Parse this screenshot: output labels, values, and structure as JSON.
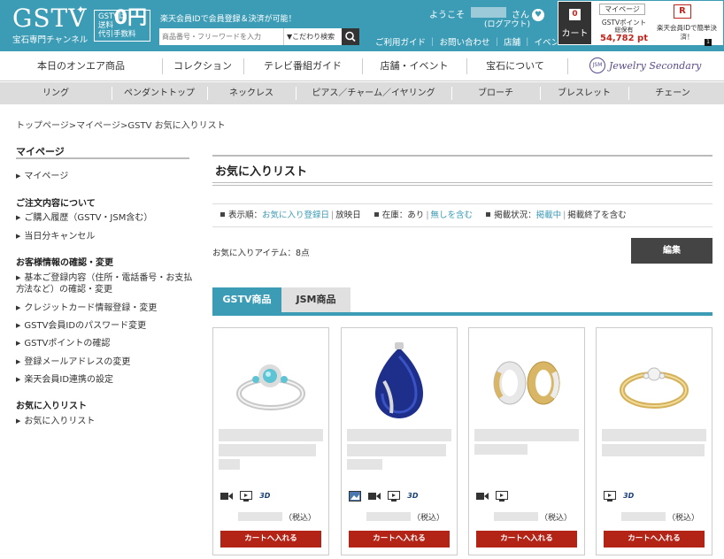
{
  "header": {
    "logo_text": "GSTV",
    "logo_sub": "宝石専門チャンネル",
    "free_line1": "GSTVは",
    "free_line2": "送料",
    "free_line3": "代引手数料",
    "free_zero": "0円",
    "promo": "楽天会員IDで会員登録＆決済が可能！",
    "search_placeholder": "商品番号・フリーワードを入力",
    "kodawari": "▼こだわり検索",
    "welcome": "ようこそ",
    "san": "さん",
    "logout": "(ログアウト)",
    "links": "ご利用ガイド ｜ お問い合わせ ｜ 店舗 ｜ イベント",
    "cart_count": "0",
    "cart_label": "カート",
    "mypage": "マイページ",
    "points_label": "GSTVポイント",
    "points_sub": "総保有",
    "points_value": "54,782 pt",
    "rakuten_mark": "R",
    "rakuten_text": "楽天会員IDで簡単決済！",
    "corner_badge": "1"
  },
  "main_nav": [
    "本日のオンエア商品",
    "コレクション",
    "テレビ番組ガイド",
    "店舗・イベント",
    "宝石について"
  ],
  "jsm_logo": "JSM",
  "jsm_text": "Jewelry Secondary Market",
  "category_nav": [
    "リング",
    "ペンダントトップ",
    "ネックレス",
    "ピアス／チャーム／イヤリング",
    "ブローチ",
    "ブレスレット",
    "チェーン"
  ],
  "breadcrumb": "トップページ>マイページ>GSTV お気に入りリスト",
  "sidebar": {
    "title": "マイページ",
    "mypage_link": "マイページ",
    "order_heading": "ご注文内容について",
    "order_items": [
      "ご購入履歴（GSTV・JSM含む）",
      "当日分キャンセル"
    ],
    "info_heading": "お客様情報の確認・変更",
    "info_item_1a": "基本ご登録内容（住所・電話番号・お支払方",
    "info_item_1b": "法など）の確認・変更",
    "info_items": [
      "クレジットカード情報登録・変更",
      "GSTV会員IDのパスワード変更",
      "GSTVポイントの確認",
      "登録メールアドレスの変更",
      "楽天会員ID連携の設定"
    ],
    "fav_heading": "お気に入りリスト",
    "fav_item": "お気に入りリスト"
  },
  "content": {
    "title": "お気に入りリスト",
    "filter_order_label": "表示順：",
    "filter_order_active": "お気に入り登録日",
    "filter_order_other": "放映日",
    "filter_stock_label": "在庫：",
    "filter_stock_active": "あり",
    "filter_stock_other": "無しを含む",
    "filter_status_label": "掲載状況：",
    "filter_status_active": "掲載中",
    "filter_status_other": "掲載終了を含む",
    "count_text": "お気に入りアイテム：8点",
    "edit_button": "編集",
    "tab_gstv": "GSTV商品",
    "tab_jsm": "JSM商品"
  },
  "products": [
    {
      "image": "aquamarine-diamond-ring",
      "icons": [
        "video-icon",
        "tv-icon",
        "3d-icon"
      ],
      "tax": "（税込）",
      "cart": "カートへ入れる"
    },
    {
      "image": "sapphire-pendant",
      "icons": [
        "photo-icon",
        "video-icon",
        "tv-icon",
        "3d-icon"
      ],
      "tax": "（税込）",
      "cart": "カートへ入れる"
    },
    {
      "image": "gold-hoop-earrings",
      "icons": [
        "video-icon",
        "tv-icon"
      ],
      "tax": "（税込）",
      "cart": "カートへ入れる"
    },
    {
      "image": "gold-diamond-ring",
      "icons": [
        "tv-icon",
        "3d-icon"
      ],
      "tax": "（税込）",
      "cart": "カートへ入れる"
    }
  ],
  "icon_3d": "3D",
  "colors": {
    "brand": "#3c9cb6",
    "cart_red": "#b32417",
    "points_red": "#c0251c",
    "jsm_purple": "#5a4a8a"
  }
}
